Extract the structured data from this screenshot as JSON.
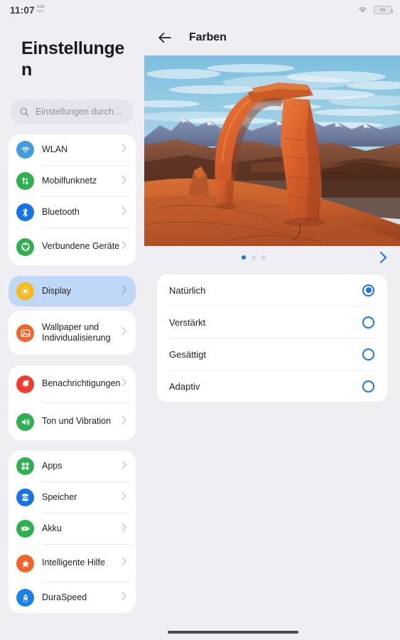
{
  "statusbar": {
    "time": "11:07",
    "net_speed": "0.00",
    "net_unit": "KB/s",
    "wifi_icon": "wifi-icon",
    "battery_level": "93"
  },
  "sidebar": {
    "title": "Einstellungen",
    "search": {
      "placeholder": "Einstellungen durch…",
      "icon": "search-icon"
    },
    "groups": [
      {
        "items": [
          {
            "label": "WLAN",
            "icon": "wifi-icon",
            "color": "#3f9de0",
            "selected": false
          },
          {
            "label": "Mobilfunknetz",
            "icon": "mobile-network-icon",
            "color": "#2eb051",
            "selected": false
          },
          {
            "label": "Bluetooth",
            "icon": "bluetooth-icon",
            "color": "#1673e8",
            "selected": false
          },
          {
            "label": "Verbundene Geräte",
            "icon": "connected-devices-icon",
            "color": "#2eb051",
            "selected": false
          }
        ]
      },
      {
        "items": [
          {
            "label": "Display",
            "icon": "brightness-icon",
            "color": "#fcb913",
            "selected": true
          }
        ]
      },
      {
        "items": [
          {
            "label": "Wallpaper und Individualisierung",
            "icon": "wallpaper-icon",
            "color": "#f4642a",
            "selected": false
          }
        ]
      },
      {
        "items": [
          {
            "label": "Benachrichtigungen",
            "icon": "bell-icon",
            "color": "#f03b2f",
            "selected": false
          },
          {
            "label": "Ton und Vibration",
            "icon": "speaker-icon",
            "color": "#2eb051",
            "selected": false
          }
        ]
      },
      {
        "items": [
          {
            "label": "Apps",
            "icon": "apps-grid-icon",
            "color": "#2eb051",
            "selected": false
          },
          {
            "label": "Speicher",
            "icon": "storage-icon",
            "color": "#1673e8",
            "selected": false
          },
          {
            "label": "Akku",
            "icon": "battery-icon",
            "color": "#2eb051",
            "selected": false
          },
          {
            "label": "Intelligente Hilfe",
            "icon": "star-icon",
            "color": "#f4642a",
            "selected": false
          },
          {
            "label": "DuraSpeed",
            "icon": "rocket-icon",
            "color": "#1a7fe8",
            "selected": false
          }
        ]
      }
    ]
  },
  "main": {
    "back_icon": "back-arrow-icon",
    "title": "Farben",
    "hero": {
      "alt": "delicate-arch-sandstone-landscape"
    },
    "carousel": {
      "dots": 3,
      "active_index": 0,
      "next_icon": "chevron-right-icon"
    },
    "options": [
      {
        "label": "Natürlich",
        "selected": true
      },
      {
        "label": "Verstärkt",
        "selected": false
      },
      {
        "label": "Gesättigt",
        "selected": false
      },
      {
        "label": "Adaptiv",
        "selected": false
      }
    ]
  },
  "colors": {
    "accent": "#1a73e8",
    "selected_row_bg": "#bfd8f7",
    "page_bg": "#eeeef3",
    "card_bg": "#ffffff"
  },
  "home_indicator": "home-indicator"
}
